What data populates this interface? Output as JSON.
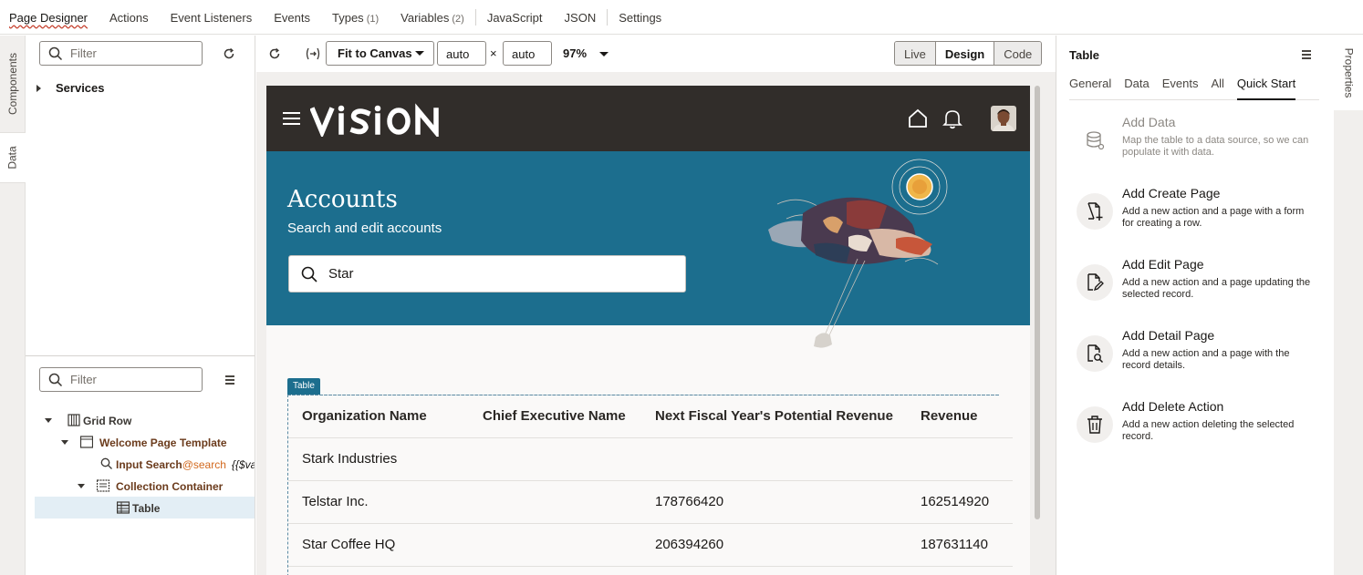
{
  "top_tabs": [
    {
      "label": "Page Designer",
      "count": "",
      "active": true
    },
    {
      "label": "Actions",
      "count": ""
    },
    {
      "label": "Event Listeners",
      "count": ""
    },
    {
      "label": "Events",
      "count": ""
    },
    {
      "label": "Types",
      "count": "(1)"
    },
    {
      "label": "Variables",
      "count": "(2)"
    },
    {
      "label": "JavaScript",
      "count": ""
    },
    {
      "label": "JSON",
      "count": ""
    },
    {
      "label": "Settings",
      "count": ""
    }
  ],
  "left_strip": {
    "components_label": "Components",
    "data_label": "Data"
  },
  "services_panel": {
    "filter_placeholder": "Filter",
    "services_label": "Services"
  },
  "structure_panel": {
    "filter_placeholder": "Filter",
    "tree": [
      {
        "label": "Grid Row"
      },
      {
        "label": "Welcome Page Template"
      },
      {
        "label": "Input Search",
        "suffix": "@search",
        "expr": "{{$va"
      },
      {
        "label": "Collection Container"
      },
      {
        "label": "Table"
      }
    ]
  },
  "canvas_toolbar": {
    "fit_label": "Fit to Canvas",
    "width_value": "auto",
    "times": "×",
    "height_value": "auto",
    "zoom": "97%",
    "modes": [
      "Live",
      "Design",
      "Code"
    ],
    "active_mode": "Design"
  },
  "app": {
    "logo_text": "VISION",
    "title": "Accounts",
    "subtitle": "Search and edit accounts",
    "search_value": "Star",
    "table_badge": "Table",
    "table": {
      "columns": [
        "Organization Name",
        "Chief Executive Name",
        "Next Fiscal Year's Potential Revenue",
        "Revenue"
      ],
      "rows": [
        [
          "Stark Industries",
          "",
          "",
          ""
        ],
        [
          "Telstar Inc.",
          "",
          "178766420",
          "162514920"
        ],
        [
          "Star Coffee HQ",
          "",
          "206394260",
          "187631140"
        ]
      ]
    }
  },
  "properties": {
    "title": "Table",
    "tabs": [
      "General",
      "Data",
      "Events",
      "All",
      "Quick Start"
    ],
    "active_tab": "Quick Start",
    "quick_start": [
      {
        "title": "Add Data",
        "desc": "Map the table to a data source, so we can populate it with data.",
        "icon": "database-icon",
        "disabled": true
      },
      {
        "title": "Add Create Page",
        "desc": "Add a new action and a page with a form for creating a row.",
        "icon": "page-add-icon"
      },
      {
        "title": "Add Edit Page",
        "desc": "Add a new action and a page updating the selected record.",
        "icon": "page-edit-icon"
      },
      {
        "title": "Add Detail Page",
        "desc": "Add a new action and a page with the record details.",
        "icon": "page-search-icon"
      },
      {
        "title": "Add Delete Action",
        "desc": "Add a new action deleting the selected record.",
        "icon": "trash-icon"
      }
    ],
    "side_tab": "Properties"
  },
  "colors": {
    "accent": "#c74634",
    "hero": "#1c6e8e",
    "header": "#312d2a",
    "tree_text": "#6b3b1c"
  }
}
